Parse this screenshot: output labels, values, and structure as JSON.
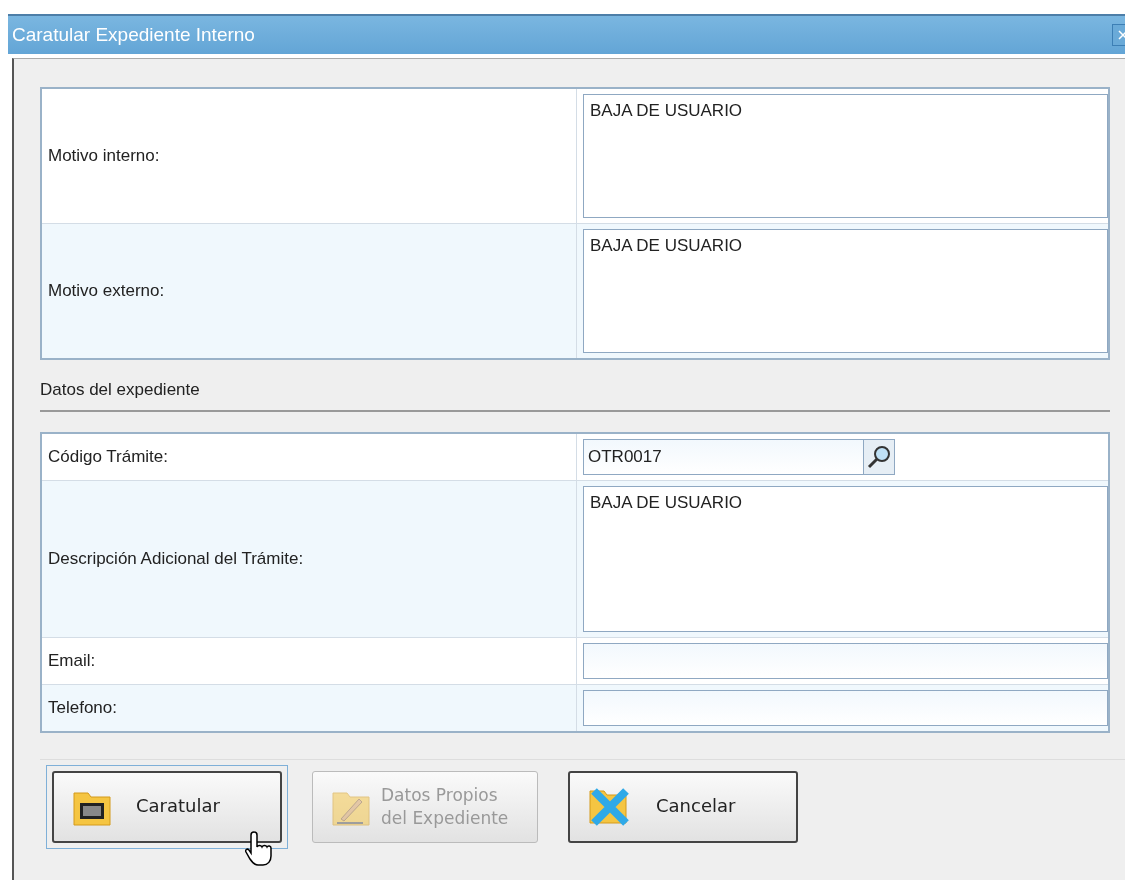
{
  "window": {
    "title": "Caratular Expediente Interno"
  },
  "motivos": [
    {
      "label": "Motivo interno:",
      "kind": "textarea",
      "value": "BAJA DE USUARIO"
    },
    {
      "label": "Motivo externo:",
      "kind": "textarea",
      "value": "BAJA DE USUARIO"
    }
  ],
  "section_title": "Datos del expediente",
  "expediente": [
    {
      "label": "Código Trámite:",
      "kind": "lookup",
      "value": "OTR0017"
    },
    {
      "label": "Descripción Adicional del Trámite:",
      "kind": "textarea",
      "value": "BAJA DE USUARIO"
    },
    {
      "label": "Email:",
      "kind": "input"
    },
    {
      "label": "Telefono:",
      "kind": "input"
    }
  ],
  "buttons": [
    {
      "label": "Caratular",
      "kind": "counter",
      "disabled": false,
      "focused": true
    },
    {
      "label": "Datos Propios\ndel Expediente",
      "kind": "pencil",
      "disabled": true,
      "focused": false
    },
    {
      "label": "Cancelar",
      "kind": "cross",
      "disabled": false,
      "focused": false
    }
  ]
}
